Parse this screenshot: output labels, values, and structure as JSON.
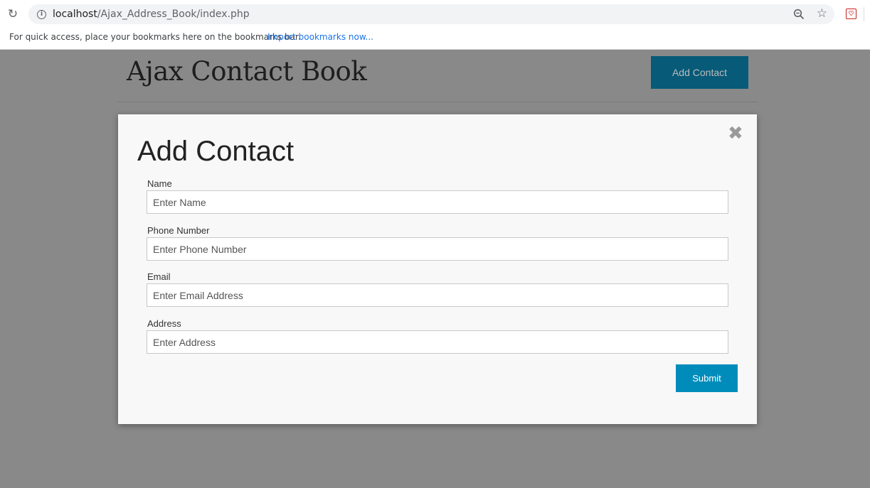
{
  "browser": {
    "url_host": "localhost",
    "url_path": "/Ajax_Address_Book/index.php",
    "bookmarks_prompt": "For quick access, place your bookmarks here on the bookmarks bar.",
    "bookmarks_import": "Import bookmarks now..."
  },
  "page": {
    "title": "Ajax Contact Book",
    "add_button": "Add Contact"
  },
  "modal": {
    "title": "Add Contact",
    "close": "✖",
    "fields": [
      {
        "label": "Name",
        "placeholder": "Enter Name"
      },
      {
        "label": "Phone Number",
        "placeholder": "Enter Phone Number"
      },
      {
        "label": "Email",
        "placeholder": "Enter Email Address"
      },
      {
        "label": "Address",
        "placeholder": "Enter Address"
      }
    ],
    "submit": "Submit"
  },
  "colors": {
    "overlay": "#898989",
    "header_button": "#075a78",
    "submit_button": "#008cba"
  }
}
